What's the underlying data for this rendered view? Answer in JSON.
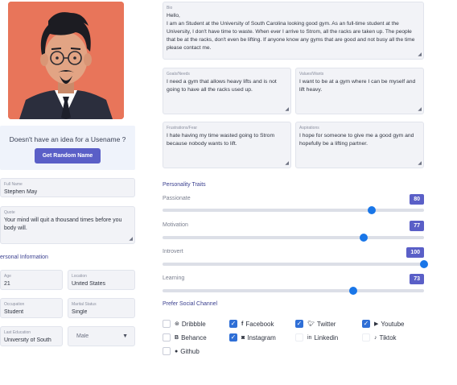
{
  "username_prompt": {
    "hint": "Doesn't have an idea for a Usename ?",
    "button": "Get Random Name"
  },
  "profile": {
    "full_name_label": "Full Name",
    "full_name": "Stephen May",
    "quote_label": "Quote",
    "quote": "Your mind will quit a thousand times before you body will."
  },
  "personal_information": {
    "title": "ersonal Information",
    "age_label": "Age",
    "age": "21",
    "location_label": "Location",
    "location": "United States",
    "occupation_label": "Occupation",
    "occupation": "Student",
    "marital_label": "Marital Status",
    "marital": "Single",
    "education_label": "Last Education",
    "education": "University of South",
    "gender": "Male"
  },
  "bio": {
    "label": "Bio",
    "text": "Hello,\nI am an Student at the University of South Carolina looking good gym. As an full-time student at the University, I don't have time to waste. When ever I arrive to Strom, all the racks are taken up. The people that be at the racks, don't even be lifting. If anyone know any gyms that are good and not busy all the time please contact me."
  },
  "goals": {
    "label": "Goals/Needs",
    "text": "I need a gym that allows heavy lifts and is not going to have all the racks used up."
  },
  "values": {
    "label": "Values/Wants",
    "text": "I want to be at a gym where I can be myself and lift heavy."
  },
  "frustrations": {
    "label": "Frustrations/Fear",
    "text": "I hate having my time wasted going to Strom because nobody wants to lift."
  },
  "aspirations": {
    "label": "Aspirations",
    "text": "I hope for someone to give me a good gym and hopefully be a lifting partner."
  },
  "traits": {
    "title": "Personality Traits",
    "items": [
      {
        "label": "Passionate",
        "value": 80
      },
      {
        "label": "Motivation",
        "value": 77
      },
      {
        "label": "Introvert",
        "value": 100
      },
      {
        "label": "Learning",
        "value": 73
      }
    ],
    "accent": "#5a5fc7",
    "thumb_color": "#1976e8"
  },
  "social": {
    "title": "Prefer Social Channel",
    "channels": [
      {
        "label": "Dribbble",
        "icon": "dribbble-icon",
        "checked": false
      },
      {
        "label": "Facebook",
        "icon": "facebook-icon",
        "checked": true
      },
      {
        "label": "Twitter",
        "icon": "twitter-icon",
        "checked": true
      },
      {
        "label": "Youtube",
        "icon": "youtube-icon",
        "checked": true
      },
      {
        "label": "Behance",
        "icon": "behance-icon",
        "checked": false
      },
      {
        "label": "Instagram",
        "icon": "instagram-icon",
        "checked": true
      },
      {
        "label": "Linkedin",
        "icon": "linkedin-icon",
        "checked": false
      },
      {
        "label": "Tiktok",
        "icon": "tiktok-icon",
        "checked": false
      },
      {
        "label": "Github",
        "icon": "github-icon",
        "checked": false
      }
    ]
  }
}
